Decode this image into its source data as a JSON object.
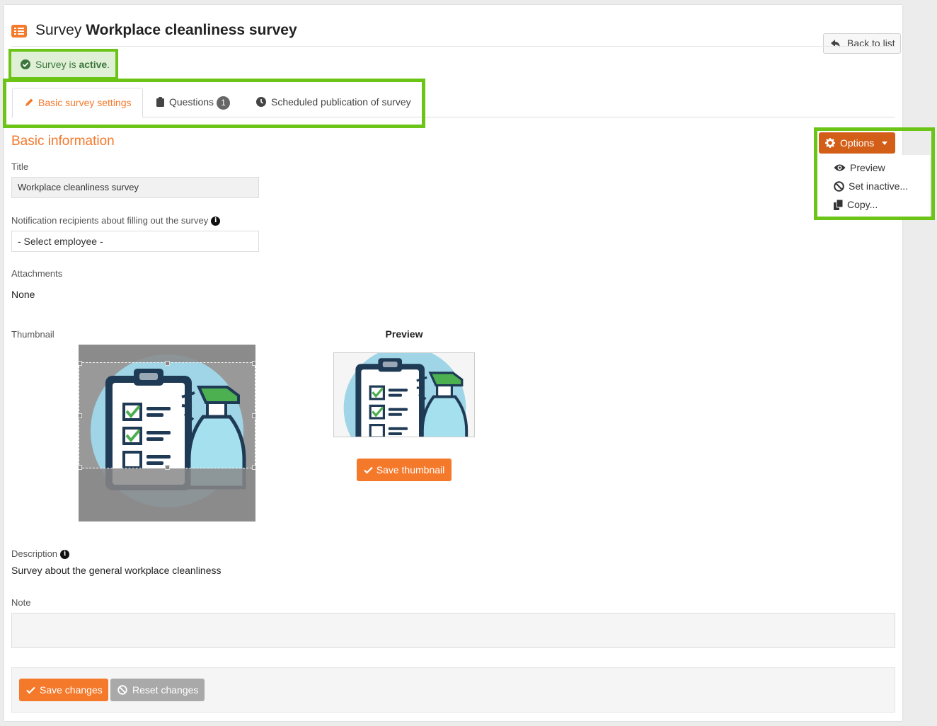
{
  "header": {
    "title_prefix": "Survey",
    "title_name": "Workplace cleanliness survey",
    "back_label": "Back to list"
  },
  "alert": {
    "text_prefix": "Survey is",
    "status": "active",
    "suffix": "."
  },
  "tabs": [
    {
      "label": "Basic survey settings",
      "active": true
    },
    {
      "label": "Questions",
      "badge": "1",
      "active": false
    },
    {
      "label": "Scheduled publication of survey",
      "active": false
    }
  ],
  "section": {
    "title": "Basic information"
  },
  "options": {
    "button_label": "Options",
    "menu": [
      {
        "label": "Preview",
        "icon": "eye-icon"
      },
      {
        "label": "Set inactive...",
        "icon": "ban-icon"
      },
      {
        "label": "Copy...",
        "icon": "copy-icon"
      }
    ]
  },
  "form": {
    "title_label": "Title",
    "title_value": "Workplace cleanliness survey",
    "recipients_label": "Notification recipients about filling out the survey",
    "recipients_value": "- Select employee -",
    "attachments_label": "Attachments",
    "attachments_value": "None",
    "thumbnail_label": "Thumbnail",
    "preview_label": "Preview",
    "save_thumbnail_label": "Save thumbnail",
    "description_label": "Description",
    "description_value": "Survey about the general workplace cleanliness",
    "note_label": "Note",
    "note_value": ""
  },
  "footer": {
    "save_label": "Save changes",
    "reset_label": "Reset changes"
  },
  "colors": {
    "accent": "#f4792b",
    "options_button": "#d35e18",
    "highlight": "#6cc417",
    "success_bg": "#e0f0d6",
    "success_text": "#3c763d"
  }
}
